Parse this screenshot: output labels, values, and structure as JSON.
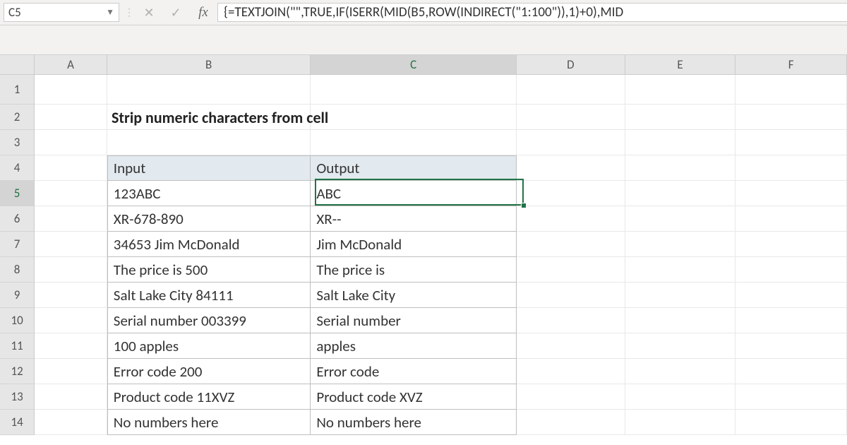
{
  "name_box": "C5",
  "formula": "{=TEXTJOIN(\"\",TRUE,IF(ISERR(MID(B5,ROW(INDIRECT(\"1:100\")),1)+0),MID",
  "columns": [
    "A",
    "B",
    "C",
    "D",
    "E",
    "F"
  ],
  "selected_col": "C",
  "rows": [
    1,
    2,
    3,
    4,
    5,
    6,
    7,
    8,
    9,
    10,
    11,
    12,
    13,
    14
  ],
  "selected_row": 5,
  "title": "Strip numeric characters from cell",
  "table_headers": {
    "input": "Input",
    "output": "Output"
  },
  "table_rows": [
    {
      "input": "123ABC",
      "output": "ABC"
    },
    {
      "input": "XR-678-890",
      "output": "XR--"
    },
    {
      "input": "34653 Jim McDonald",
      "output": " Jim McDonald"
    },
    {
      "input": "The price is 500",
      "output": "The price is "
    },
    {
      "input": "Salt Lake City 84111",
      "output": "Salt Lake City "
    },
    {
      "input": "Serial number 003399",
      "output": "Serial number "
    },
    {
      "input": "100 apples",
      "output": " apples"
    },
    {
      "input": "Error code 200",
      "output": "Error code "
    },
    {
      "input": "Product code 11XVZ",
      "output": "Product code XVZ"
    },
    {
      "input": "No numbers here",
      "output": "No numbers here"
    }
  ],
  "active_cell": {
    "row": 5,
    "col": "C"
  }
}
